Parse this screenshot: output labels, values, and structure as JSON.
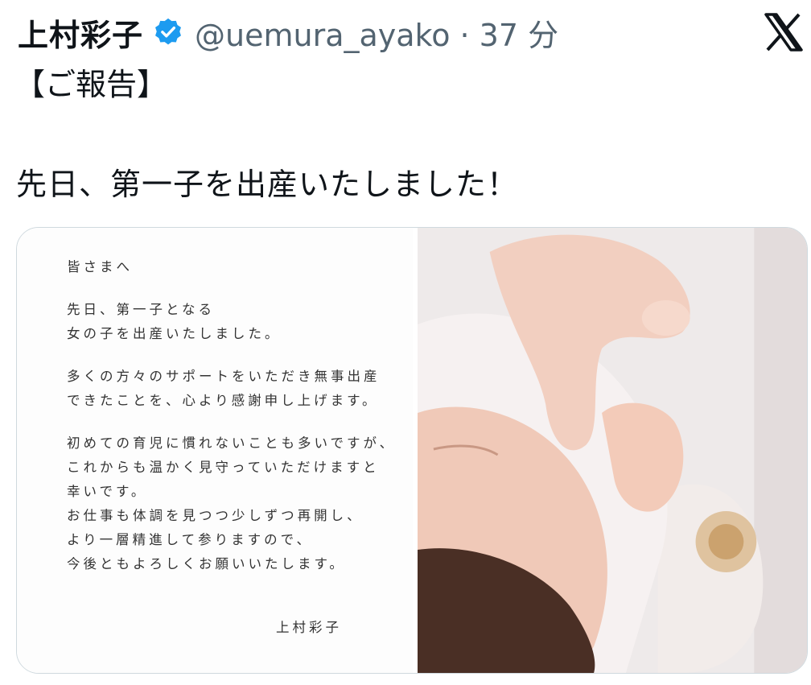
{
  "post": {
    "author_name": "上村彩子",
    "handle_time": "@uemura_ayako · 37 分",
    "title": "【ご報告】",
    "body": "先日、第一子を出産いたしました！"
  },
  "icons": {
    "verified": "verified-badge-icon",
    "platform": "x-logo-icon"
  },
  "colors": {
    "verified_blue": "#1d9bf0",
    "handle_gray": "#536471"
  },
  "letter": {
    "lines": [
      "皆さまへ",
      "",
      "先日、第一子となる",
      "女の子を出産いたしました。",
      "",
      "多くの方々のサポートをいただき無事出産",
      "できたことを、心より感謝申し上げます。",
      "",
      "初めての育児に慣れないことも多いですが、",
      "これからも温かく見守っていただけますと",
      "幸いです。",
      "お仕事も体調を見つつ少しずつ再開し、",
      "より一層精進して参りますので、",
      "今後ともよろしくお願いいたします。"
    ],
    "signature": "上村彩子"
  }
}
